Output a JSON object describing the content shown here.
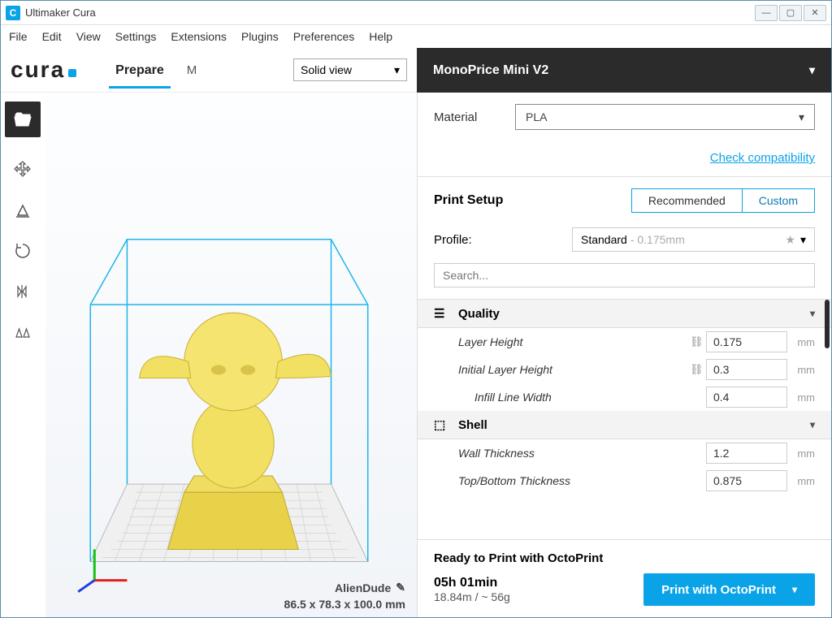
{
  "app": {
    "title": "Ultimaker Cura",
    "icon_letter": "C"
  },
  "menubar": [
    "File",
    "Edit",
    "View",
    "Settings",
    "Extensions",
    "Plugins",
    "Preferences",
    "Help"
  ],
  "nav": {
    "prepare": "Prepare",
    "partial": "M"
  },
  "view_mode": "Solid view",
  "printer": "MonoPrice Mini V2",
  "material": {
    "label": "Material",
    "value": "PLA",
    "compat": "Check compatibility"
  },
  "print_setup": {
    "label": "Print Setup",
    "recommended": "Recommended",
    "custom": "Custom"
  },
  "profile": {
    "label": "Profile:",
    "name": "Standard",
    "detail": " - 0.175mm"
  },
  "search_placeholder": "Search...",
  "categories": {
    "quality": "Quality",
    "shell": "Shell"
  },
  "settings": {
    "layer_height": {
      "name": "Layer Height",
      "value": "0.175",
      "unit": "mm",
      "linked": true
    },
    "initial_layer_height": {
      "name": "Initial Layer Height",
      "value": "0.3",
      "unit": "mm",
      "linked": true
    },
    "infill_line_width": {
      "name": "Infill Line Width",
      "value": "0.4",
      "unit": "mm",
      "linked": false
    },
    "wall_thickness": {
      "name": "Wall Thickness",
      "value": "1.2",
      "unit": "mm",
      "linked": false
    },
    "top_bottom_thickness": {
      "name": "Top/Bottom Thickness",
      "value": "0.875",
      "unit": "mm",
      "linked": false
    }
  },
  "ready": "Ready to Print with OctoPrint",
  "time": "05h 01min",
  "filament": "18.84m / ~ 56g",
  "print_button": "Print with OctoPrint",
  "model": {
    "name": "AlienDude",
    "dims": "86.5 x 78.3 x 100.0 mm"
  }
}
